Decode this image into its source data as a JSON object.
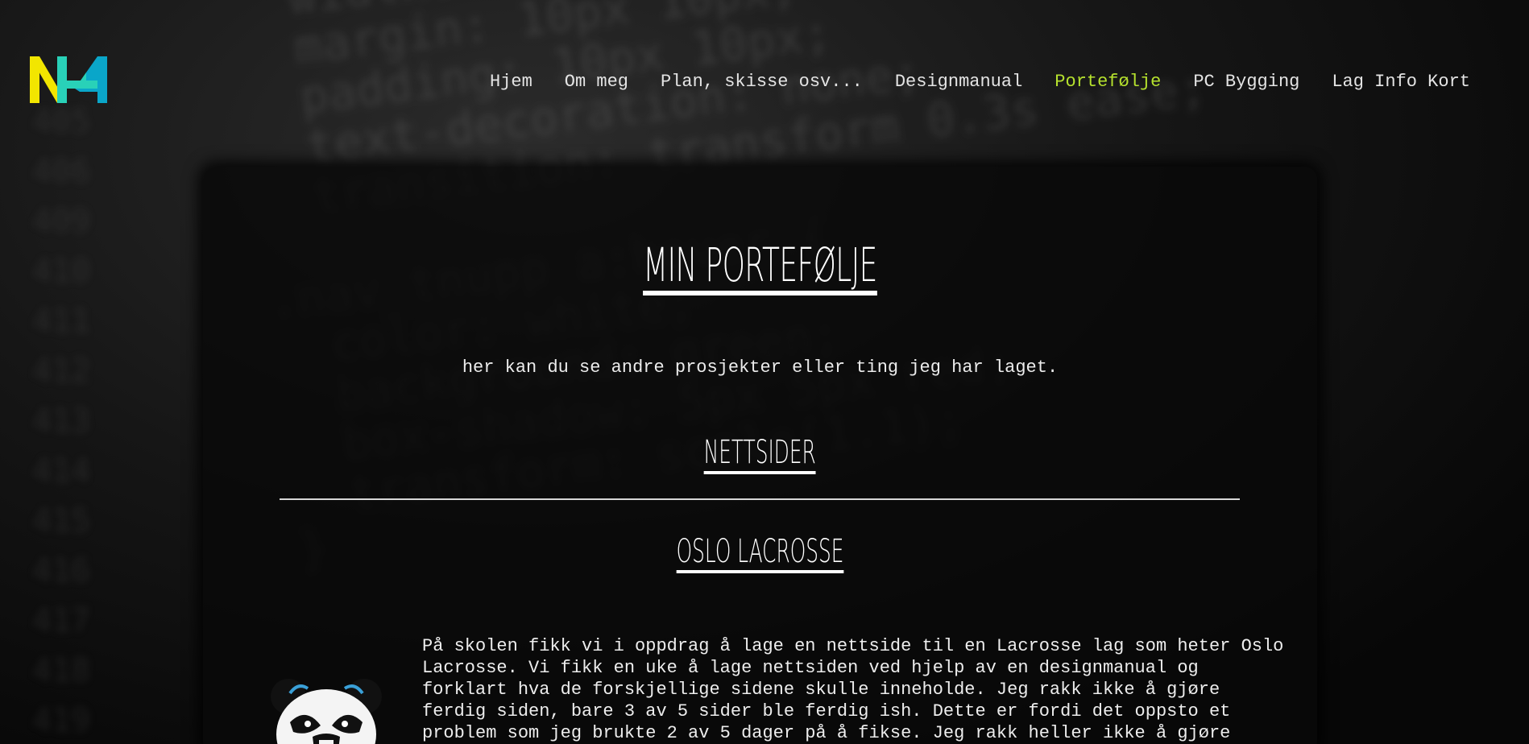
{
  "logo": {
    "icon": "nh-logo",
    "colors": [
      "#f2e600",
      "#29d1b8",
      "#0aa6c9"
    ]
  },
  "nav": {
    "items": [
      {
        "label": "Hjem",
        "active": false
      },
      {
        "label": "Om meg",
        "active": false
      },
      {
        "label": "Plan, skisse osv...",
        "active": false
      },
      {
        "label": "Designmanual",
        "active": false
      },
      {
        "label": "Portefølje",
        "active": true
      },
      {
        "label": "PC Bygging",
        "active": false
      },
      {
        "label": "Lag Info Kort",
        "active": false
      }
    ],
    "active_color": "#b6e22e"
  },
  "main": {
    "title": "Min Portefølje",
    "intro": "her kan du se andre prosjekter eller ting jeg har laget.",
    "section_title": "Nettsider",
    "project": {
      "title": "Oslo Lacrosse",
      "image_icon": "panda-mascot-logo",
      "description": "På skolen fikk vi i oppdrag å lage en nettside til en Lacrosse lag som heter Oslo Lacrosse. Vi fikk en uke å lage nettsiden ved hjelp av en designmanual og forklart hva de forskjellige sidene skulle inneholde. Jeg rakk ikke å gjøre ferdig siden, bare 3 av 5 sider ble ferdig ish. Dette er fordi det oppsto et problem som jeg brukte 2 av 5 dager på å fikse. Jeg rakk heller ikke å gjøre nettsiden responsiv slik at man kan bruke den på"
    }
  }
}
